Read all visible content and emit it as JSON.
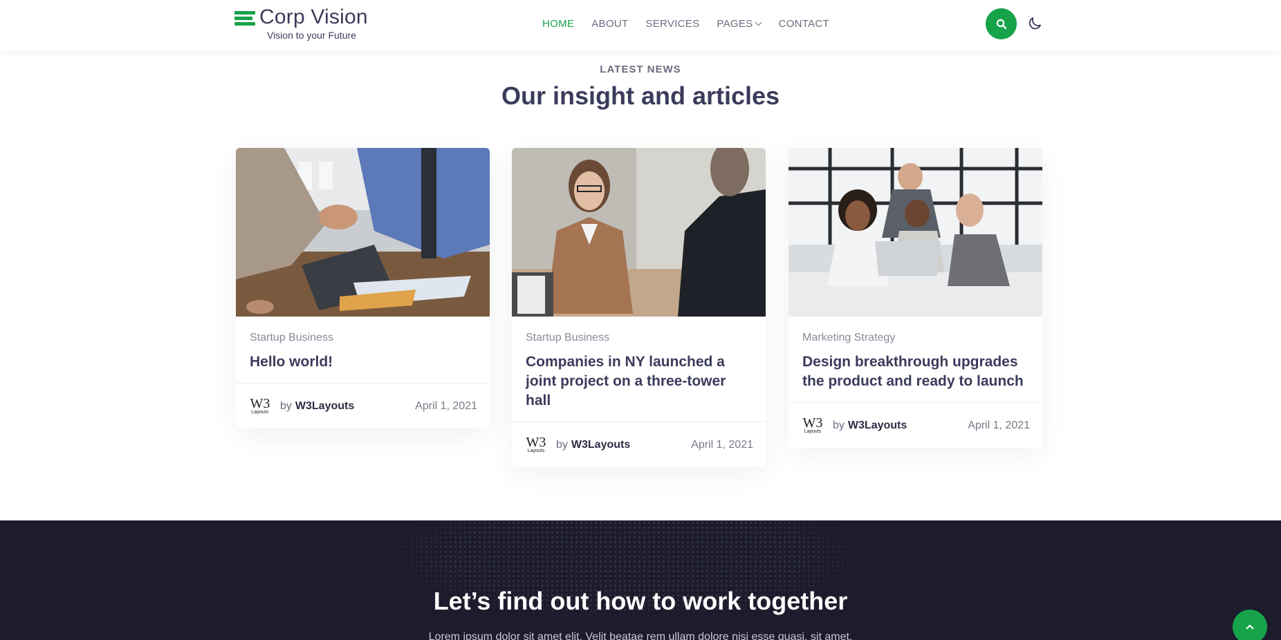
{
  "header": {
    "logo_title": "Corp Vision",
    "logo_tagline": "Vision to your Future",
    "nav": [
      {
        "label": "Home",
        "active": true
      },
      {
        "label": "About"
      },
      {
        "label": "Services"
      },
      {
        "label": "Pages",
        "dropdown": true
      },
      {
        "label": "Contact"
      }
    ],
    "search_icon": "search-icon",
    "theme_icon": "moon-icon"
  },
  "section": {
    "eyebrow": "LATEST NEWS",
    "title": "Our insight and articles"
  },
  "cards": [
    {
      "category": "Startup Business",
      "title": "Hello world!",
      "by": "by",
      "author": "W3Layouts",
      "date": "April 1, 2021",
      "image": "handshake-photo"
    },
    {
      "category": "Startup Business",
      "title": "Companies in NY launched a joint project on a three-tower hall",
      "by": "by",
      "author": "W3Layouts",
      "date": "April 1, 2021",
      "image": "interview-photo"
    },
    {
      "category": "Marketing Strategy",
      "title": "Design breakthrough upgrades the product and ready to launch",
      "by": "by",
      "author": "W3Layouts",
      "date": "April 1, 2021",
      "image": "team-laptop-photo"
    }
  ],
  "author_logo": {
    "main": "W3",
    "sub": "Layouts"
  },
  "cta": {
    "title": "Let’s find out how to work together",
    "text": "Lorem ipsum dolor sit amet elit. Velit beatae rem ullam dolore nisi esse quasi, sit amet."
  },
  "colors": {
    "accent": "#17a34a",
    "heading": "#3b3b5c",
    "dark_band": "#1c1c2c"
  }
}
